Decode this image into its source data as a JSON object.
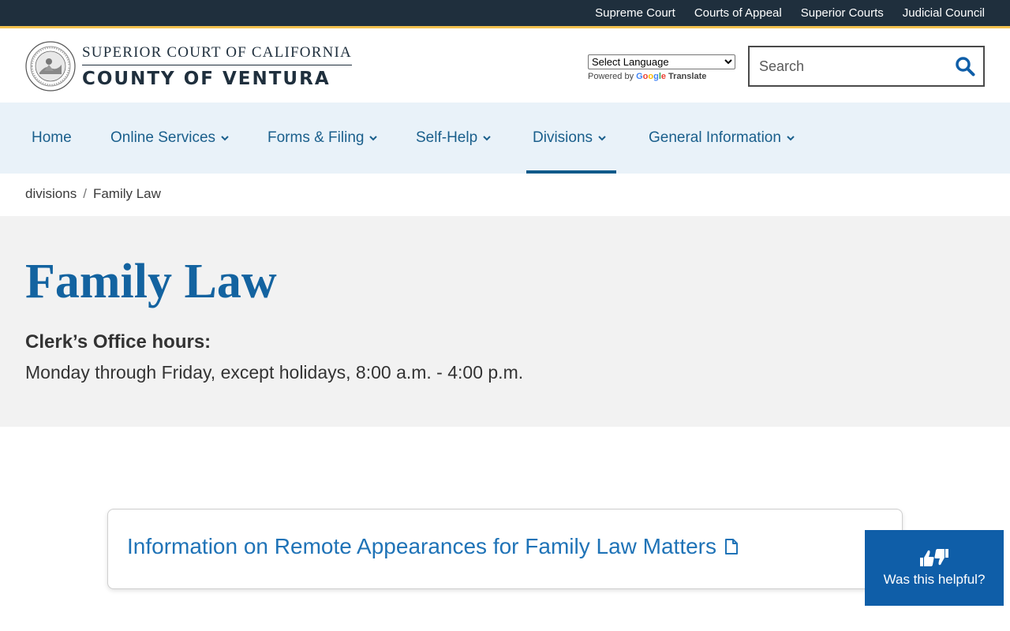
{
  "topbar": {
    "links": [
      "Supreme Court",
      "Courts of Appeal",
      "Superior Courts",
      "Judicial Council"
    ]
  },
  "header": {
    "logo_line1": "SUPERIOR COURT OF CALIFORNIA",
    "logo_line2": "COUNTY OF VENTURA",
    "seal_icon": "court-seal-icon",
    "translate_select": "Select Language",
    "powered_by": "Powered by",
    "google": "Google",
    "translate": "Translate",
    "search_placeholder": "Search",
    "search_icon": "search-icon"
  },
  "nav": {
    "items": [
      {
        "label": "Home",
        "dropdown": false
      },
      {
        "label": "Online Services",
        "dropdown": true
      },
      {
        "label": "Forms & Filing",
        "dropdown": true
      },
      {
        "label": "Self-Help",
        "dropdown": true
      },
      {
        "label": "Divisions",
        "dropdown": true,
        "active": true
      },
      {
        "label": "General Information",
        "dropdown": true
      }
    ]
  },
  "breadcrumb": {
    "items": [
      "divisions",
      "Family Law"
    ],
    "separator": "/"
  },
  "hero": {
    "title": "Family Law",
    "hours_label": "Clerk’s Office hours:",
    "hours_text": "Monday through Friday, except holidays, 8:00 a.m. - 4:00 p.m."
  },
  "card": {
    "link_text": "Information on Remote Appearances for Family Law Matters",
    "icon": "document-icon"
  },
  "feedback": {
    "label": "Was this helpful?",
    "icon": "thumbs-up-down-icon"
  },
  "colors": {
    "topbar_bg": "#1f2f3d",
    "topbar_accent": "#f2c14e",
    "nav_bg": "#e9f2f9",
    "nav_text": "#1a5f8c",
    "title_blue": "#1363a0",
    "hero_bg": "#f2f2f2",
    "feedback_bg": "#0f5ea8"
  }
}
